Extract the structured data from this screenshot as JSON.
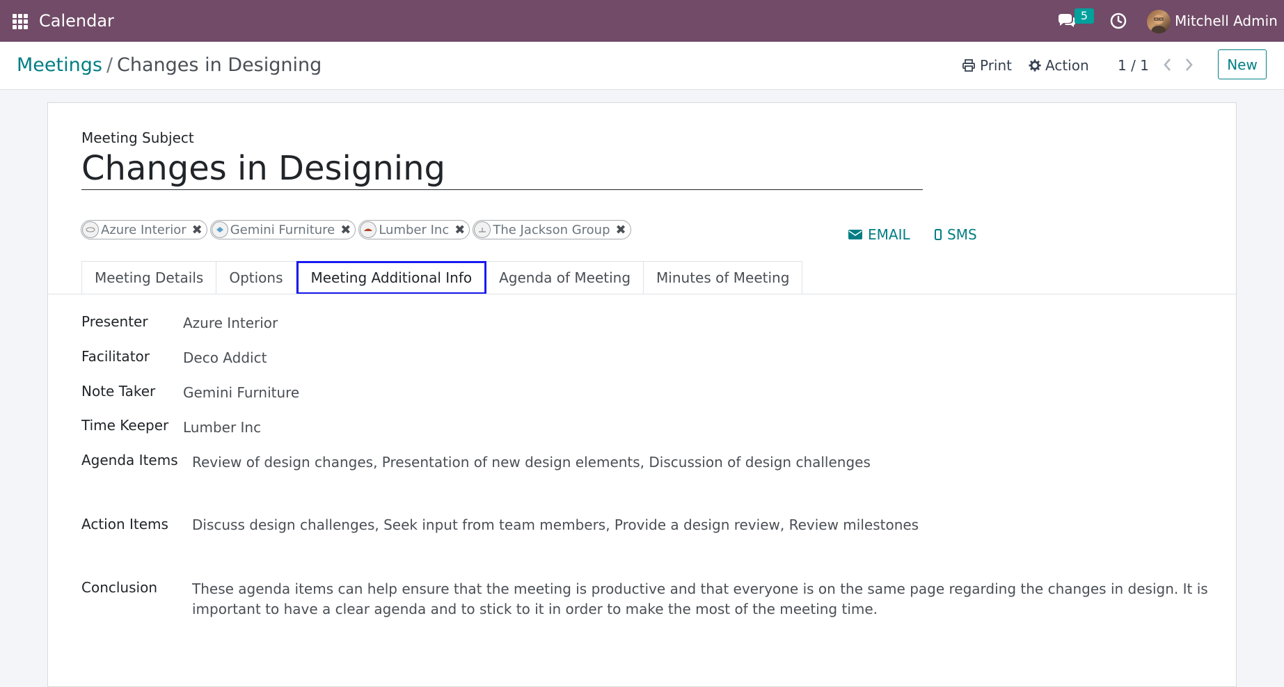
{
  "app": {
    "title": "Calendar",
    "notification_count": "5",
    "user_name": "Mitchell Admin"
  },
  "breadcrumb": {
    "parent": "Meetings",
    "separator": "/",
    "current": "Changes in Designing"
  },
  "toolbar": {
    "print_label": "Print",
    "action_label": "Action",
    "pager": "1 / 1",
    "new_label": "New"
  },
  "form": {
    "subject_label": "Meeting Subject",
    "subject_value": "Changes in Designing",
    "attendees": [
      "Azure Interior",
      "Gemini Furniture",
      "Lumber Inc",
      "The Jackson Group"
    ],
    "email_label": "EMAIL",
    "sms_label": "SMS"
  },
  "tabs": [
    "Meeting Details",
    "Options",
    "Meeting Additional Info",
    "Agenda of Meeting",
    "Minutes of Meeting"
  ],
  "active_tab": "Meeting Additional Info",
  "fields": {
    "presenter": {
      "label": "Presenter",
      "value": "Azure Interior"
    },
    "facilitator": {
      "label": "Facilitator",
      "value": "Deco Addict"
    },
    "note_taker": {
      "label": "Note Taker",
      "value": "Gemini Furniture"
    },
    "time_keeper": {
      "label": "Time Keeper",
      "value": "Lumber Inc"
    },
    "agenda_items": {
      "label": "Agenda Items",
      "value": "Review of design changes, Presentation of new design elements, Discussion of design challenges"
    },
    "action_items": {
      "label": "Action Items",
      "value": "Discuss design challenges, Seek input from team members, Provide a design review, Review milestones"
    },
    "conclusion": {
      "label": "Conclusion",
      "value_line1": "These agenda items can help ensure that the meeting is productive and that everyone is on the same page regarding the changes in design. It is",
      "value_line2": "important to have a clear agenda and to stick to it in order to make the most of the meeting time."
    }
  },
  "colors": {
    "topbar": "#714b67",
    "accent": "#017e84",
    "badge": "#00a09d",
    "active_tab_border": "#1a1af0"
  }
}
